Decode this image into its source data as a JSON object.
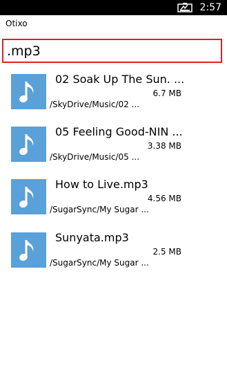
{
  "status_bar": {
    "time": "2:57",
    "battery_icon": "battery-charging-icon"
  },
  "app": {
    "title": "Otixo"
  },
  "search": {
    "value": ".mp3"
  },
  "files": [
    {
      "name": "02 Soak Up The Sun. ...",
      "size": "6.7 MB",
      "path": "/SkyDrive/Music/02  ...",
      "icon": "music-note-icon"
    },
    {
      "name": "05 Feeling Good-NIN ...",
      "size": "3.38 MB",
      "path": "/SkyDrive/Music/05  ...",
      "icon": "music-note-icon"
    },
    {
      "name": "How to Live.mp3",
      "size": "4.56 MB",
      "path": "/SugarSync/My Sugar  ...",
      "icon": "music-note-icon"
    },
    {
      "name": "Sunyata.mp3",
      "size": "2.5 MB",
      "path": "/SugarSync/My Sugar  ...",
      "icon": "music-note-icon"
    }
  ],
  "colors": {
    "accent_border": "#e01f25",
    "thumb_bg": "#5aa0d9"
  }
}
